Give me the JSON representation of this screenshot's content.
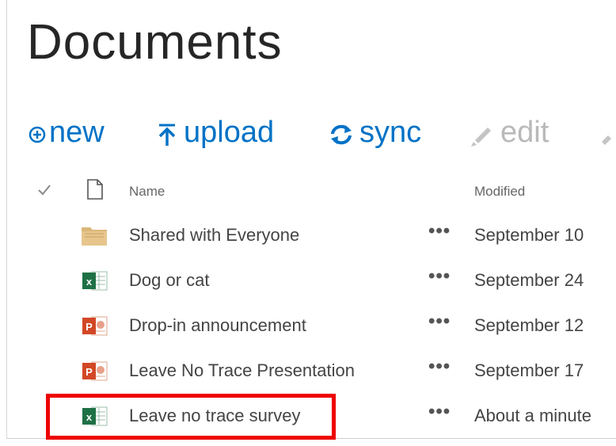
{
  "page": {
    "title": "Documents"
  },
  "toolbar": {
    "new_label": "new",
    "upload_label": "upload",
    "sync_label": "sync",
    "edit_label": "edit"
  },
  "list": {
    "columns": {
      "name": "Name",
      "modified": "Modified"
    },
    "rows": [
      {
        "name": "Shared with Everyone",
        "modified": "September 10",
        "type": "folder-icon"
      },
      {
        "name": "Dog or cat",
        "modified": "September 24",
        "type": "excel-icon"
      },
      {
        "name": "Drop-in announcement",
        "modified": "September 12",
        "type": "powerpoint-icon"
      },
      {
        "name": "Leave No Trace Presentation",
        "modified": "September 17",
        "type": "powerpoint-icon"
      },
      {
        "name": "Leave no trace survey",
        "modified": "About a minute",
        "type": "excel-icon"
      }
    ],
    "ellipsis": "•••"
  },
  "colors": {
    "accent": "#0072c6",
    "disabled": "#b9b9b9",
    "highlight": "#ee0000",
    "excel": "#1e7145",
    "powerpoint": "#d24726",
    "folder": "#dcb67a"
  }
}
